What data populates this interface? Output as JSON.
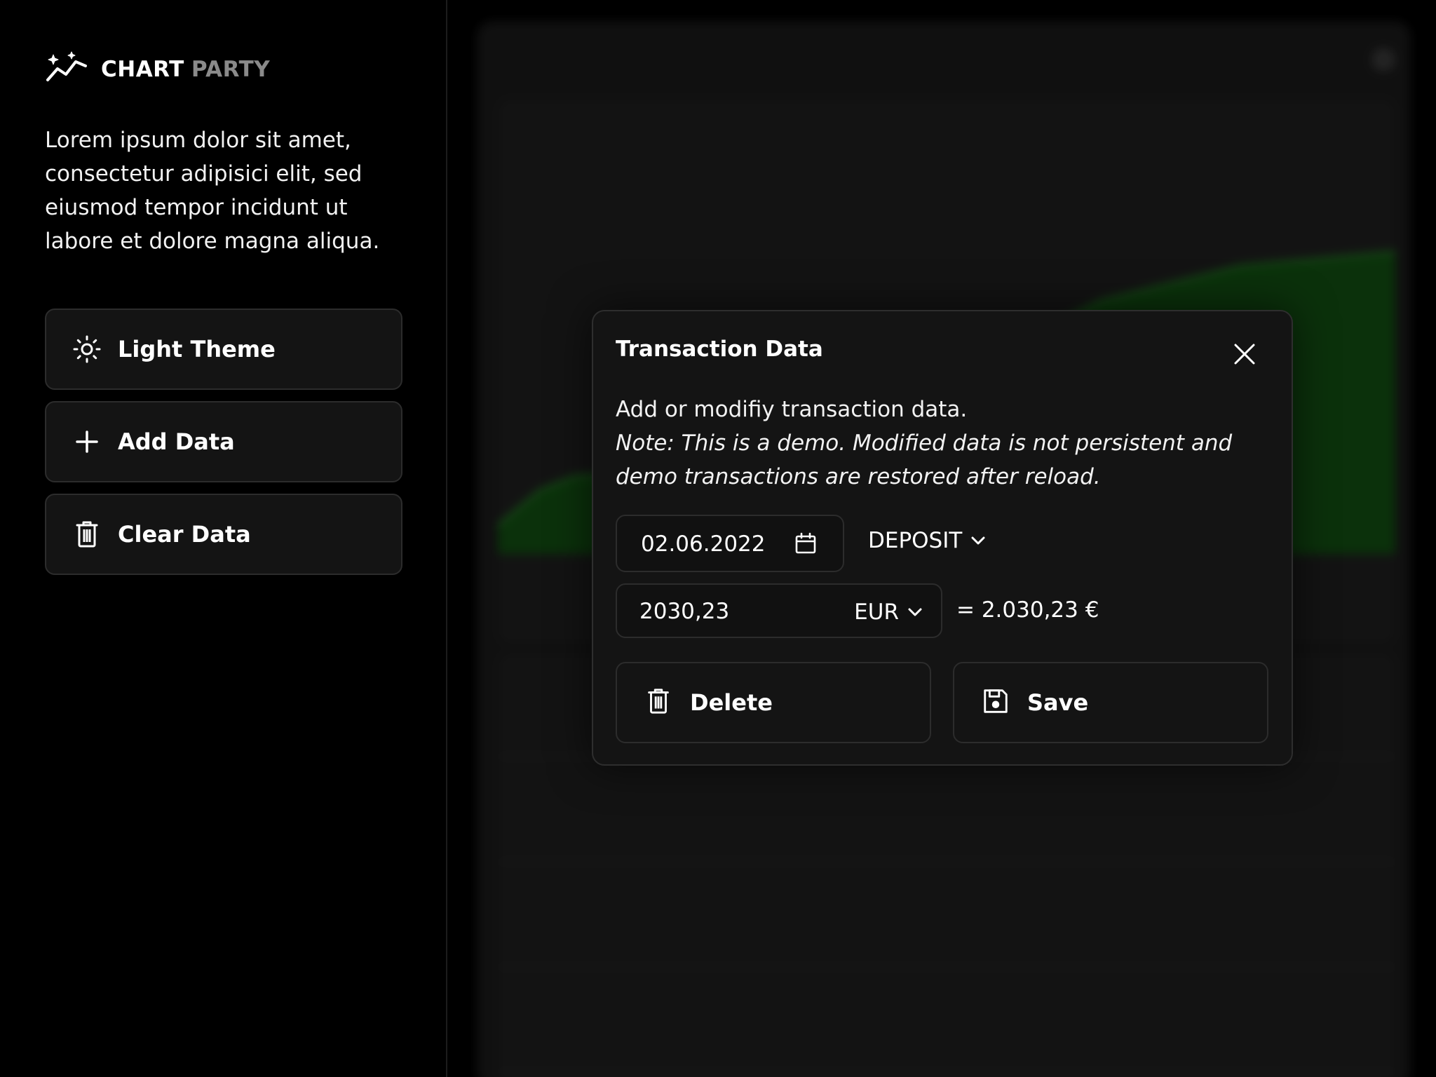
{
  "sidebar": {
    "logo": {
      "word1": "CHART",
      "word2": "PARTY",
      "icon": "sparkle-chart-icon"
    },
    "intro": "Lorem ipsum dolor sit amet, consectetur adipisici elit, sed eiusmod tempor incidunt ut labore et dolore magna aliqua.",
    "buttons": [
      {
        "label": "Light Theme",
        "icon": "sun-icon"
      },
      {
        "label": "Add Data",
        "icon": "plus-icon"
      },
      {
        "label": "Clear Data",
        "icon": "trash-icon"
      }
    ]
  },
  "modal": {
    "title": "Transaction Data",
    "description": "Add or modifiy transaction data.",
    "note": "Note: This is a demo. Modified data is not persistent and demo transactions are restored after reload.",
    "date": "02.06.2022",
    "type": "DEPOSIT",
    "amount": "2030,23",
    "currency": "EUR",
    "converted": "= 2.030,23 €",
    "delete_label": "Delete",
    "save_label": "Save"
  },
  "colors": {
    "accent_green": "#1f7a1f",
    "background": "#000000",
    "panel": "#141414",
    "border": "#2c2c2c"
  }
}
